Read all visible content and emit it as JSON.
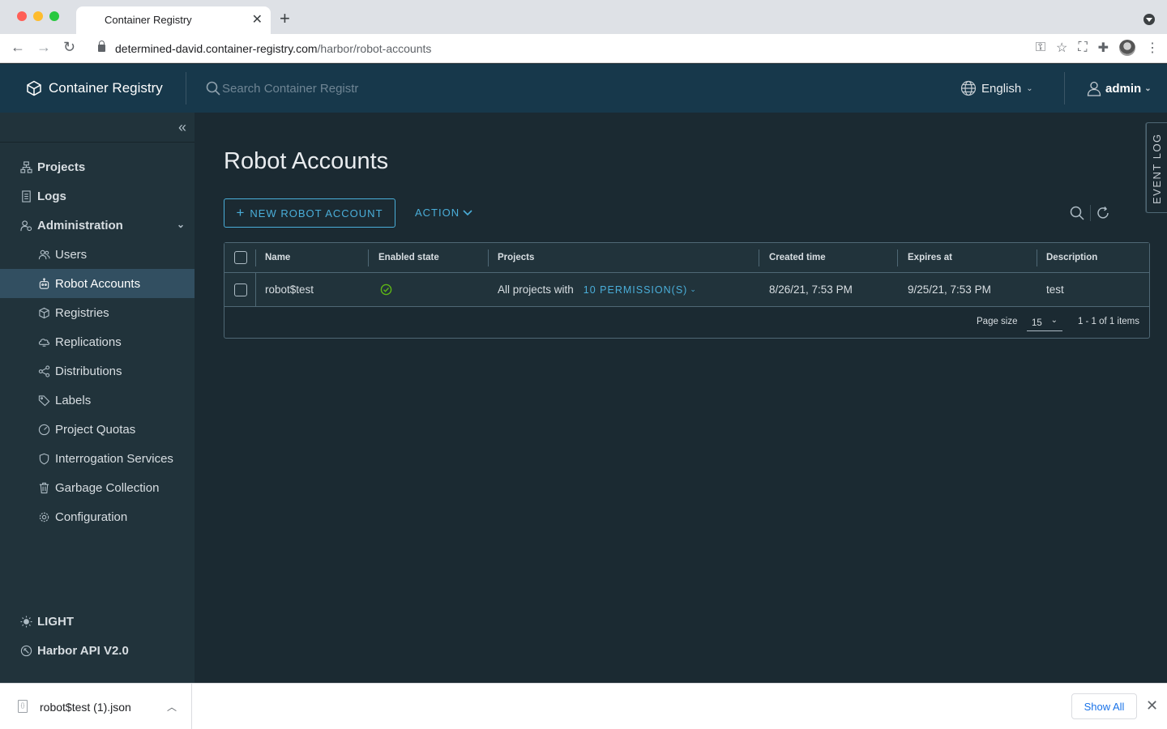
{
  "browser": {
    "tab_title": "Container Registry",
    "url_host": "determined-david.container-registry.com",
    "url_path": "/harbor/robot-accounts"
  },
  "header": {
    "brand": "Container Registry",
    "search_placeholder": "Search Container Registr",
    "language": "English",
    "user": "admin"
  },
  "sidebar": {
    "items": [
      {
        "label": "Projects",
        "icon": "projects-icon"
      },
      {
        "label": "Logs",
        "icon": "logs-icon"
      },
      {
        "label": "Administration",
        "icon": "administration-icon"
      },
      {
        "label": "Users",
        "icon": "users-icon"
      },
      {
        "label": "Robot Accounts",
        "icon": "robot-icon",
        "active": true
      },
      {
        "label": "Registries",
        "icon": "registries-icon"
      },
      {
        "label": "Replications",
        "icon": "replications-icon"
      },
      {
        "label": "Distributions",
        "icon": "distributions-icon"
      },
      {
        "label": "Labels",
        "icon": "tag-icon"
      },
      {
        "label": "Project Quotas",
        "icon": "dashboard-icon"
      },
      {
        "label": "Interrogation Services",
        "icon": "shield-icon"
      },
      {
        "label": "Garbage Collection",
        "icon": "trash-icon"
      },
      {
        "label": "Configuration",
        "icon": "gear-icon"
      }
    ],
    "theme_toggle": "LIGHT",
    "api_link": "Harbor API V2.0"
  },
  "main": {
    "title": "Robot Accounts",
    "new_button": "NEW ROBOT ACCOUNT",
    "action_button": "ACTION",
    "event_log": "EVENT LOG",
    "table": {
      "columns": [
        "Name",
        "Enabled state",
        "Projects",
        "Created time",
        "Expires at",
        "Description"
      ],
      "rows": [
        {
          "name": "robot$test",
          "enabled": true,
          "projects_prefix": "All projects with",
          "permissions": "10 PERMISSION(S)",
          "created": "8/26/21, 7:53 PM",
          "expires": "9/25/21, 7:53 PM",
          "description": "test"
        }
      ],
      "page_size_label": "Page size",
      "page_size": "15",
      "count": "1 - 1 of 1 items"
    }
  },
  "downloads": {
    "file": "robot$test (1).json",
    "show_all": "Show All"
  },
  "colors": {
    "header_bg": "#17384b",
    "sidebar_bg": "#21333b",
    "main_bg": "#1b2a32",
    "accent": "#4aaed9",
    "active_nav": "#324f61",
    "success": "#5eb715"
  }
}
